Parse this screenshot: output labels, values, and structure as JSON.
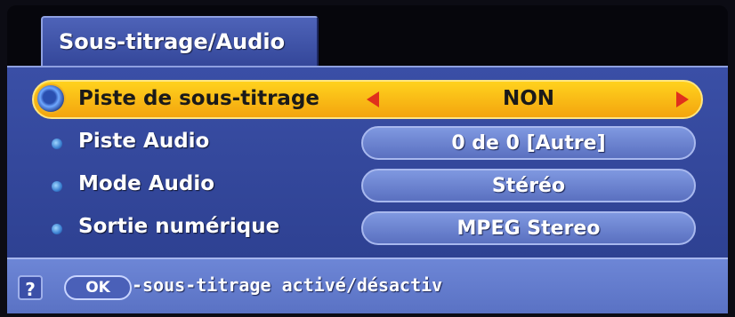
{
  "window": {
    "tab_title": "Sous-titrage/Audio"
  },
  "menu": {
    "items": [
      {
        "label": "Piste de sous-titrage",
        "value": "NON",
        "selected": true
      },
      {
        "label": "Piste Audio",
        "value": "0 de 0 [Autre]",
        "selected": false
      },
      {
        "label": "Mode Audio",
        "value": "Stéréo",
        "selected": false
      },
      {
        "label": "Sortie numérique",
        "value": "MPEG Stereo",
        "selected": false
      }
    ]
  },
  "footer": {
    "help_icon": "?",
    "ok_label": "OK",
    "hint": "-sous-titrage activé/désactiv"
  },
  "colors": {
    "panel": "#3a4fa6",
    "highlight": "#ffd21e",
    "arrow": "#e0301c",
    "pill": "#6d86d6"
  },
  "icons": [
    "bullet-icon",
    "arrow-left-icon",
    "arrow-right-icon",
    "help-icon"
  ]
}
